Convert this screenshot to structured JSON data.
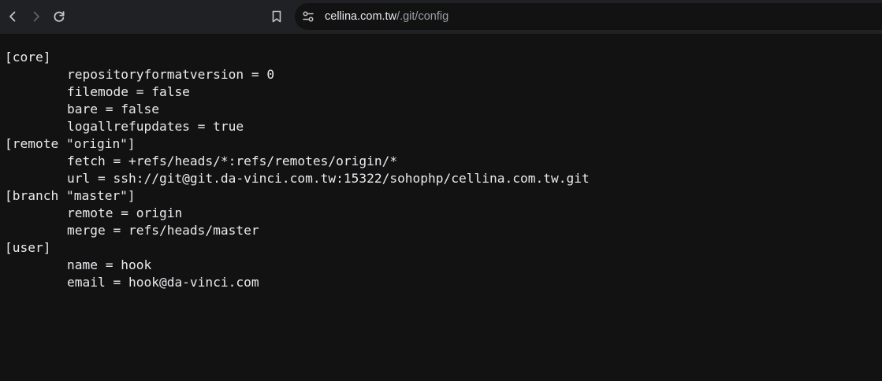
{
  "toolbar": {
    "url_host": "cellina.com.tw",
    "url_path": "/.git/config",
    "icons": [
      "back-arrow-icon",
      "forward-arrow-icon",
      "reload-icon",
      "bookmark-icon",
      "site-info-icon"
    ]
  },
  "config": {
    "lines": [
      {
        "text": "[core]",
        "indent": false
      },
      {
        "text": "repositoryformatversion = 0",
        "indent": true
      },
      {
        "text": "filemode = false",
        "indent": true
      },
      {
        "text": "bare = false",
        "indent": true
      },
      {
        "text": "logallrefupdates = true",
        "indent": true
      },
      {
        "text": "[remote \"origin\"]",
        "indent": false
      },
      {
        "text": "fetch = +refs/heads/*:refs/remotes/origin/*",
        "indent": true
      },
      {
        "text": "url = ssh://git@git.da-vinci.com.tw:15322/sohophp/cellina.com.tw.git",
        "indent": true
      },
      {
        "text": "[branch \"master\"]",
        "indent": false
      },
      {
        "text": "remote = origin",
        "indent": true
      },
      {
        "text": "merge = refs/heads/master",
        "indent": true
      },
      {
        "text": "[user]",
        "indent": false
      },
      {
        "text": "name = hook",
        "indent": true
      },
      {
        "text": "email = hook@da-vinci.com",
        "indent": true
      }
    ]
  }
}
